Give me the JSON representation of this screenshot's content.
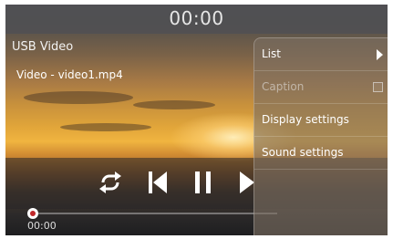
{
  "player": {
    "time_top": "00:00",
    "source": "USB Video",
    "file": "Video - video1.mp4",
    "elapsed": "00:00",
    "progress": 0.0
  },
  "controls": {
    "repeat_icon": "repeat-icon",
    "previous_icon": "skip-previous-icon",
    "pause_icon": "pause-icon",
    "next_icon": "play-next-icon"
  },
  "menu": {
    "items": [
      {
        "label": "List",
        "indicator": "chevron-right-icon",
        "enabled": true
      },
      {
        "label": "Caption",
        "indicator": "checkbox",
        "enabled": false,
        "checked": false
      },
      {
        "label": "Display settings",
        "enabled": true
      },
      {
        "label": "Sound settings",
        "enabled": true
      }
    ]
  },
  "colors": {
    "knob_accent": "#c0282a",
    "text": "#ffffff"
  }
}
